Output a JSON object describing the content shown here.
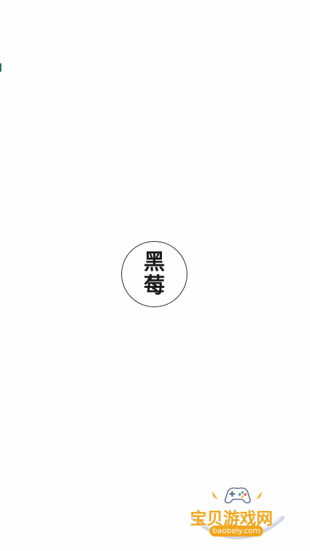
{
  "logo": {
    "line1": "黑",
    "line2": "莓"
  },
  "watermark": {
    "text": "宝贝游戏网",
    "url": "baobeiy.com",
    "icon": "gamepad-icon"
  },
  "colors": {
    "background": "#fefefe",
    "logo_ink": "#1a1a1a",
    "watermark_orange": "#f3a51c",
    "edge_mark": "#1f6f6a"
  }
}
